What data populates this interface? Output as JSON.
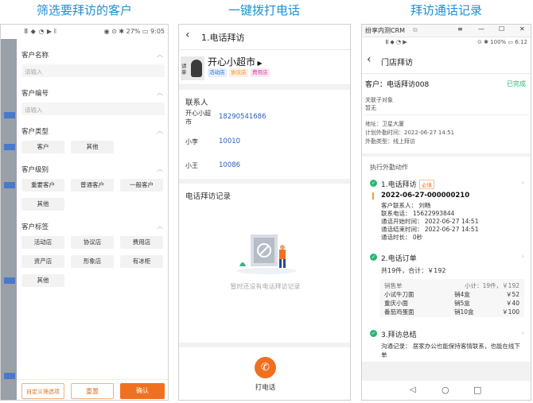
{
  "captions": {
    "c1": "筛选要拜访的客户",
    "c2": "一键拨打电话",
    "c3": "拜访通话记录"
  },
  "p1": {
    "status_left": "𝄃𝄃 ◆ ◔ ▶ 𝄃",
    "status_right": "◉ ⊙ ✱ 27% ▭ 9:05",
    "sections": {
      "name": {
        "title": "客户名称",
        "placeholder": "请输入"
      },
      "code": {
        "title": "客户编号",
        "placeholder": "请输入"
      },
      "type": {
        "title": "客户类型",
        "chips": [
          "客户",
          "其他"
        ]
      },
      "level": {
        "title": "客户级别",
        "chips": [
          "重要客户",
          "普通客户",
          "一般客户",
          "其他"
        ]
      },
      "tags": {
        "title": "客户标签",
        "chips": [
          "活动店",
          "协议店",
          "费用店",
          "资产店",
          "形象店",
          "有冰柜",
          "其他"
        ]
      }
    },
    "buttons": {
      "custom": "自定义筛选项",
      "reset": "重置",
      "confirm": "确认"
    }
  },
  "p2": {
    "title": "1.电话拜访",
    "avatar_text": "请拿",
    "store_name": "开心小超市",
    "tags": [
      "活动店",
      "协议店",
      "费用店"
    ],
    "contacts_title": "联系人",
    "contacts": [
      {
        "name": "开心小超市",
        "phone": "18290541686"
      },
      {
        "name": "小李",
        "phone": "10010"
      },
      {
        "name": "小王",
        "phone": "10086"
      }
    ],
    "records_title": "电话拜访记录",
    "empty_text": "暂时还没有电话拜访记录",
    "call_label": "打电话"
  },
  "p3": {
    "window_title": "纷享内测CRM",
    "status_right": "⊙ ✱ 100% ▭ 6:12",
    "page_title": "门店拜访",
    "customer": "客户：电话拜访008",
    "state": "已完成",
    "related_label": "关联子对象",
    "related_value": "暂无",
    "address": "地址：卫星大厦",
    "plan_time": "计划外勤时间：2022-06-27 14:51",
    "visit_type": "外勤类型：线上拜访",
    "exec_title": "执行外勤动作",
    "actions": [
      {
        "title": "1.电话拜访",
        "badge": "必填",
        "record_id": "2022-06-27-000000210",
        "lines": [
          "客户联系人：  刘畅",
          "联系电话：  15622993844",
          "通话开始时间：  2022-06-27 14:51",
          "通话结束时间：  2022-06-27 14:51",
          "通话时长：  0秒"
        ]
      },
      {
        "title": "2.电话订单",
        "summary": "共19件，合计：￥192",
        "order_head": {
          "label": "销售单",
          "subtotal": "小计：19件，￥192"
        },
        "order_items": [
          {
            "name": "小试牛刀面",
            "qty": "销4盒",
            "price": "￥52"
          },
          {
            "name": "重庆小面",
            "qty": "销5盒",
            "price": "￥40"
          },
          {
            "name": "番茄鸡蛋面",
            "qty": "销10盒",
            "price": "￥100"
          }
        ]
      },
      {
        "title": "3.拜访总结",
        "summary": "沟通记录：  居家办公也能保持客情联系，也能在线下单"
      }
    ]
  },
  "colors": {
    "accent": "#1e8fd6",
    "orange": "#f07020",
    "green": "#2bb673",
    "link": "#2b5fb8"
  }
}
